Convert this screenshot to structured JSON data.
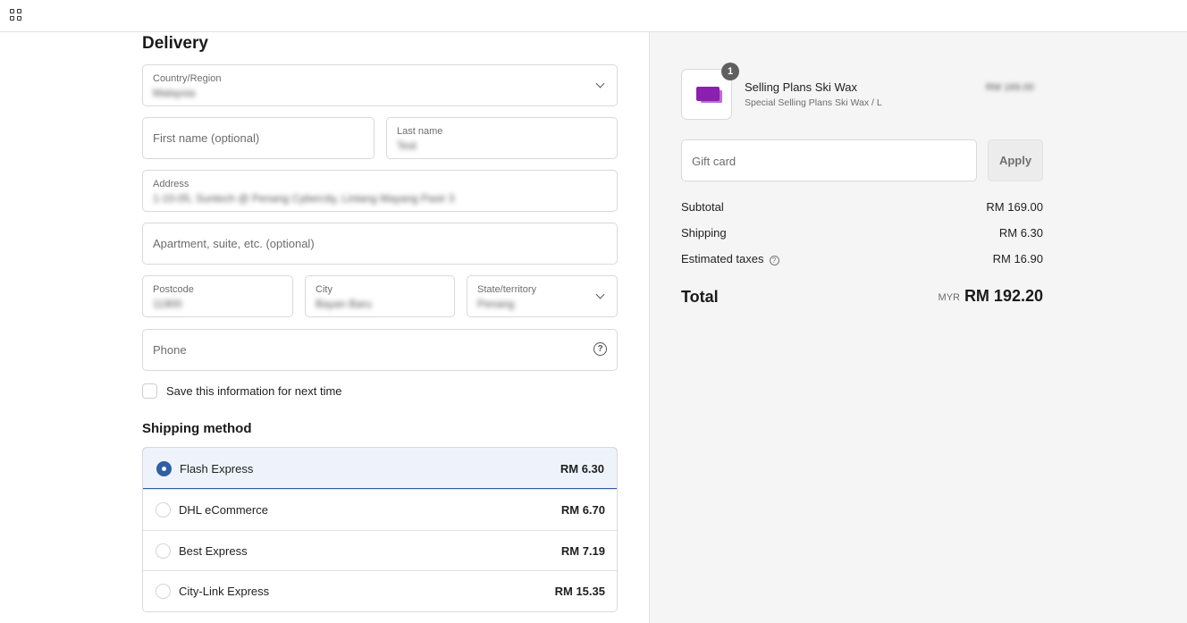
{
  "topbar": {
    "icon": "grid-icon"
  },
  "delivery": {
    "heading": "Delivery",
    "country": {
      "label": "Country/Region",
      "value": "Malaysia"
    },
    "first_name": {
      "placeholder": "First name (optional)"
    },
    "last_name": {
      "label": "Last name",
      "value": "Test"
    },
    "address": {
      "label": "Address",
      "value": "1-10-05, Suntech @ Penang Cybercity, Lintang Mayang Pasir 3"
    },
    "apartment": {
      "placeholder": "Apartment, suite, etc. (optional)"
    },
    "postcode": {
      "label": "Postcode",
      "value": "11900"
    },
    "city": {
      "label": "City",
      "value": "Bayan Baru"
    },
    "state": {
      "label": "State/territory",
      "value": "Penang"
    },
    "phone": {
      "placeholder": "Phone"
    },
    "save_info_label": "Save this information for next time"
  },
  "shipping": {
    "heading": "Shipping method",
    "options": [
      {
        "name": "Flash Express",
        "price": "RM 6.30",
        "selected": true
      },
      {
        "name": "DHL eCommerce",
        "price": "RM 6.70",
        "selected": false
      },
      {
        "name": "Best Express",
        "price": "RM 7.19",
        "selected": false
      },
      {
        "name": "City-Link Express",
        "price": "RM 15.35",
        "selected": false
      }
    ]
  },
  "summary": {
    "product": {
      "quantity": "1",
      "name": "Selling Plans Ski Wax",
      "variant": "Special Selling Plans Ski Wax / L",
      "price": "RM 169.00",
      "thumb_color": "#8a1fb0"
    },
    "gift_card": {
      "placeholder": "Gift card",
      "apply_label": "Apply"
    },
    "subtotal": {
      "label": "Subtotal",
      "value": "RM 169.00"
    },
    "shipping": {
      "label": "Shipping",
      "value": "RM 6.30"
    },
    "taxes": {
      "label": "Estimated taxes",
      "value": "RM 16.90"
    },
    "total": {
      "label": "Total",
      "currency": "MYR",
      "value": "RM 192.20"
    }
  },
  "colors": {
    "accent": "#2f5fa5",
    "summary_bg": "#f5f5f5",
    "selected_bg": "#eef3fb"
  }
}
